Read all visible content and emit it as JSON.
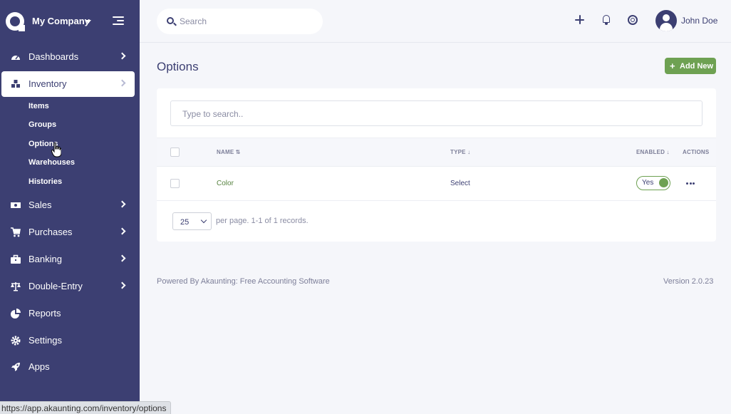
{
  "sidebar": {
    "company": "My Company",
    "items": [
      {
        "label": "Dashboards",
        "icon": "gauge-icon"
      },
      {
        "label": "Inventory",
        "icon": "boxes-icon"
      },
      {
        "label": "Sales",
        "icon": "money-icon"
      },
      {
        "label": "Purchases",
        "icon": "cart-icon"
      },
      {
        "label": "Banking",
        "icon": "briefcase-icon"
      },
      {
        "label": "Double-Entry",
        "icon": "scale-icon"
      },
      {
        "label": "Reports",
        "icon": "pie-chart-icon"
      },
      {
        "label": "Settings",
        "icon": "gear-icon"
      },
      {
        "label": "Apps",
        "icon": "rocket-icon"
      }
    ],
    "inventory_sub": [
      "Items",
      "Groups",
      "Options",
      "Warehouses",
      "Histories"
    ]
  },
  "header": {
    "search_placeholder": "Search",
    "user_name": "John Doe"
  },
  "main": {
    "title": "Options",
    "add_button": "Add New",
    "table_search_placeholder": "Type to search..",
    "columns": {
      "name": "NAME",
      "type": "TYPE",
      "enabled": "ENABLED",
      "actions": "ACTIONS"
    },
    "rows": [
      {
        "name": "Color",
        "type": "Select",
        "enabled": "Yes"
      }
    ],
    "per_page": "25",
    "pager_text": "per page. 1-1 of 1 records."
  },
  "footer": {
    "powered": "Powered By Akaunting: Free Accounting Software",
    "version": "Version 2.0.23"
  },
  "status_url": "https://app.akaunting.com/inventory/options",
  "colors": {
    "sidebar": "#3c3f72",
    "accent": "#6ea152"
  }
}
